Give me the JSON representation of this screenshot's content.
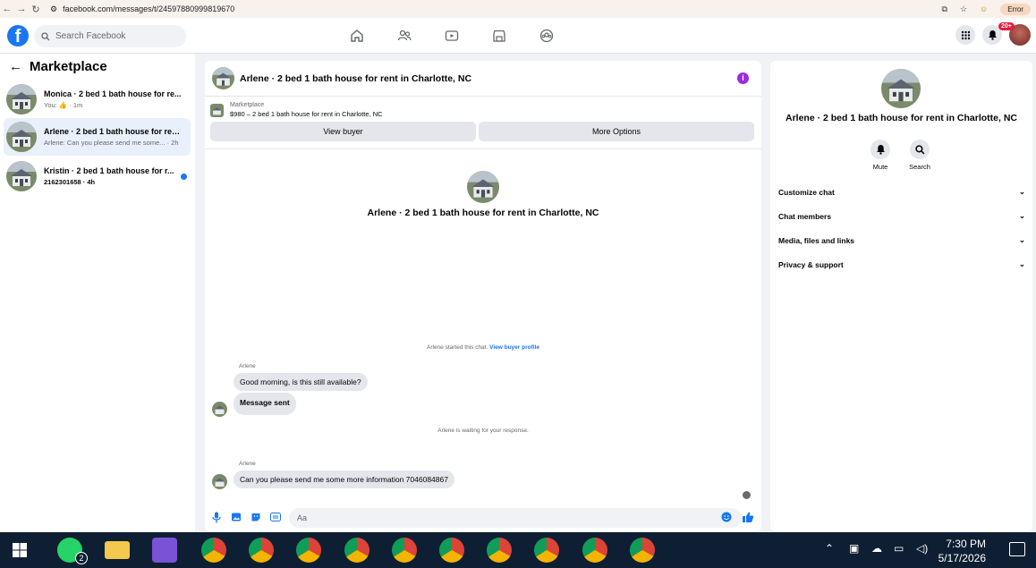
{
  "browser": {
    "url": "facebook.com/messages/t/24597880999819670",
    "status_label": "Error"
  },
  "header": {
    "logo": "f",
    "search_placeholder": "Search Facebook",
    "notification_count": "20+"
  },
  "sidebar": {
    "title": "Marketplace",
    "conversations": [
      {
        "title": "Monica · 2 bed 1 bath house for re...",
        "preview_prefix": "You:",
        "preview_suffix": "· 1m",
        "unread": false,
        "active": false
      },
      {
        "title": "Arlene · 2 bed 1 bath house for ren...",
        "preview": "Arlene: Can you please send me some...  · 2h",
        "unread": false,
        "active": true
      },
      {
        "title": "Kristin · 2 bed 1 bath house for r...",
        "preview": "2162301658 · 4h",
        "unread": true,
        "active": false
      }
    ]
  },
  "chat": {
    "header_title": "Arlene · 2 bed 1 bath house for rent in Charlotte, NC",
    "marketplace_label": "Marketplace",
    "listing": "$980 – 2 bed 1 bath house for rent in Charlotte, NC",
    "view_buyer_label": "View buyer",
    "more_options_label": "More Options",
    "center_title": "Arlene · 2 bed 1 bath house for rent in Charlotte, NC",
    "started_text": "Arlene started this chat.",
    "view_profile_link": "View buyer profile",
    "messages": [
      {
        "sender": "Arlene",
        "text": "Good morning, is this still available?"
      },
      {
        "sender": "",
        "text": "Message sent"
      },
      {
        "sender": "Arlene",
        "text": "Can you please send me some more information 7046084867"
      }
    ],
    "waiting_text": "Arlene is waiting for your response.",
    "composer_placeholder": "Aa"
  },
  "details": {
    "title": "Arlene · 2 bed 1 bath house for rent in Charlotte, NC",
    "actions": [
      {
        "label": "Mute",
        "icon": "bell-icon"
      },
      {
        "label": "Search",
        "icon": "search-icon"
      }
    ],
    "sections": [
      "Customize chat",
      "Chat members",
      "Media, files and links",
      "Privacy & support"
    ]
  },
  "taskbar": {
    "whatsapp_badge": "2",
    "time": "7:30 PM",
    "date": "5/17/2026"
  },
  "colors": {
    "brand": "#1877f2",
    "info": "#9a2be0",
    "taskbar": "#0f1f33"
  }
}
